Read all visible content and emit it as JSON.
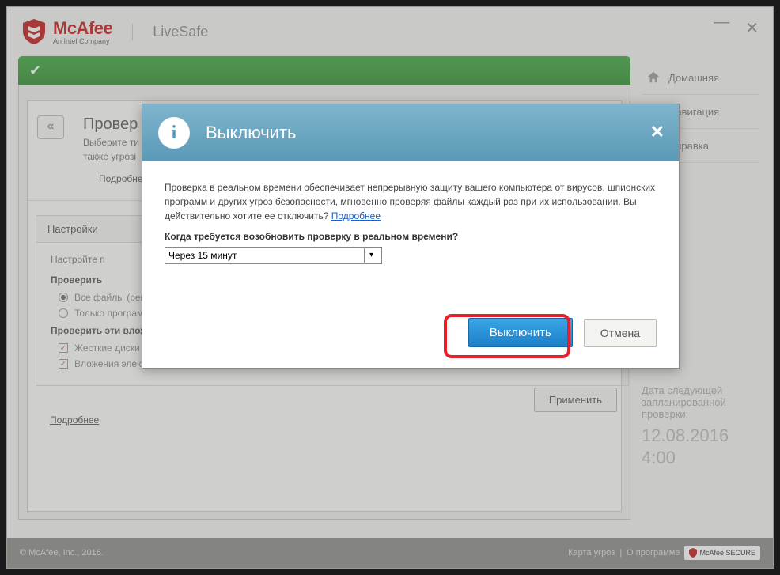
{
  "brand": {
    "name": "McAfee",
    "tagline": "An Intel Company",
    "product": "LiveSafe"
  },
  "panel": {
    "title": "Провер",
    "desc1": "Выберите ти",
    "desc2": "также угрозі",
    "more": "Подробнее"
  },
  "tab": {
    "label": "Настройки"
  },
  "settings": {
    "desc": "Настройте п",
    "group1": "Проверить",
    "radio1": "Все файлы (рекомендуется)",
    "radio2": "Только программы и документы",
    "group2": "Проверить эти вложения и расположения",
    "chk1": "Жесткие диски ПК (автоматически)",
    "chk2": "Вложения электронной почты",
    "more": "Подробнее",
    "apply": "Применить"
  },
  "nav": {
    "home": "Домашняя",
    "navigation": "Навигация",
    "help": "Справка"
  },
  "sched": {
    "label": "Дата следующей запланированной проверки:",
    "date": "12.08.2016",
    "time": "4:00"
  },
  "footer": {
    "copyright": "© McAfee, Inc., 2016.",
    "map": "Карта угроз",
    "about": "О программе",
    "secure": "McAfee SECURE"
  },
  "dialog": {
    "title": "Выключить",
    "body": "Проверка в реальном времени обеспечивает непрерывную защиту вашего компьютера от вирусов, шпионских программ и других угроз безопасности, мгновенно проверяя файлы каждый раз при их использовании. Вы действительно хотите ее отключить?",
    "link": "Подробнее",
    "question": "Когда требуется возобновить проверку в реальном времени?",
    "select_value": "Через 15 минут",
    "primary": "Выключить",
    "cancel": "Отмена"
  }
}
